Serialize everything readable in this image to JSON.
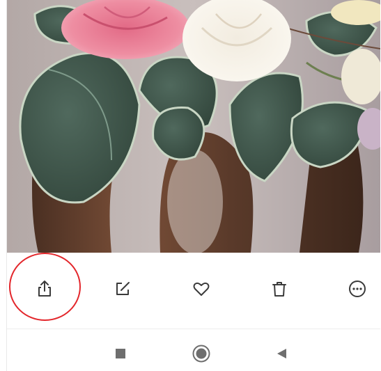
{
  "photo": {
    "subject": "flowers-in-vase-photo"
  },
  "toolbar": {
    "actions": [
      {
        "id": "share",
        "icon": "share-icon"
      },
      {
        "id": "edit",
        "icon": "edit-icon"
      },
      {
        "id": "favorite",
        "icon": "heart-icon"
      },
      {
        "id": "delete",
        "icon": "trash-icon"
      },
      {
        "id": "more",
        "icon": "more-options-icon"
      }
    ],
    "icon_color": "#3a3a3a",
    "highlight_color": "#e3262b"
  },
  "navbar": {
    "buttons": [
      {
        "id": "recents",
        "icon": "square-icon"
      },
      {
        "id": "home",
        "icon": "home-circle-icon"
      },
      {
        "id": "back",
        "icon": "back-triangle-icon"
      }
    ],
    "icon_color": "#6e6e6e"
  }
}
